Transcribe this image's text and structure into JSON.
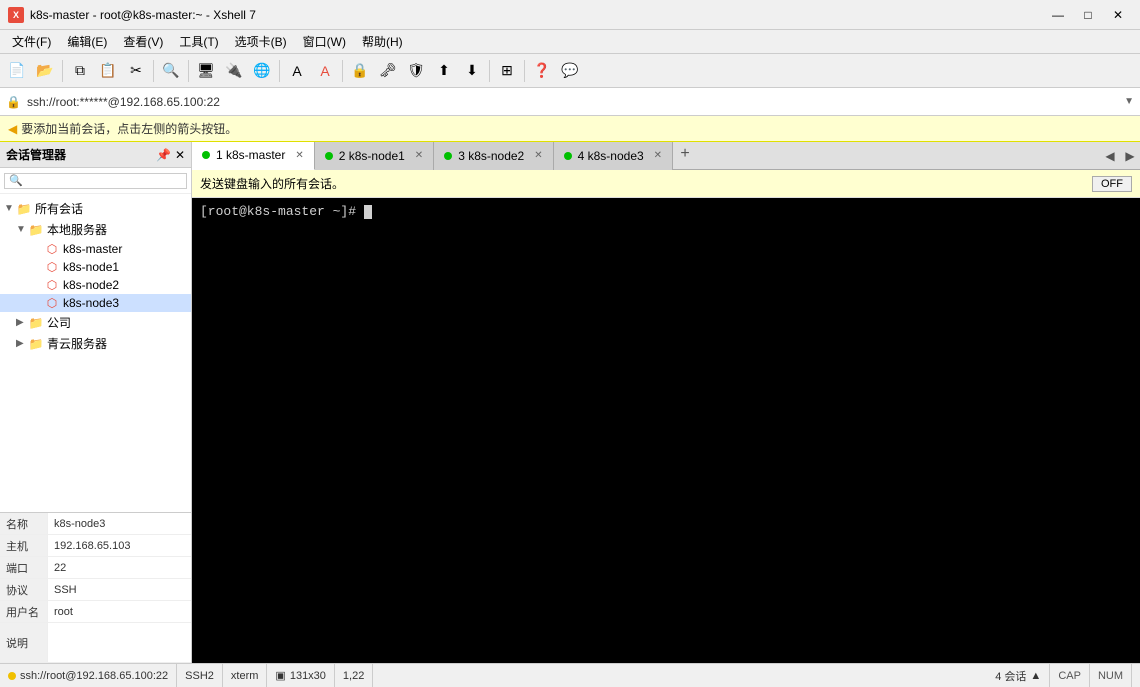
{
  "titlebar": {
    "icon_label": "X",
    "title": "k8s-master - root@k8s-master:~ - Xshell 7",
    "minimize": "—",
    "maximize": "□",
    "close": "✕"
  },
  "menu": {
    "items": [
      {
        "label": "文件(F)"
      },
      {
        "label": "编辑(E)"
      },
      {
        "label": "查看(V)"
      },
      {
        "label": "工具(T)"
      },
      {
        "label": "选项卡(B)"
      },
      {
        "label": "窗口(W)"
      },
      {
        "label": "帮助(H)"
      }
    ]
  },
  "address_bar": {
    "text": "ssh://root:******@192.168.65.100:22"
  },
  "hint_bar": {
    "text": "要添加当前会话，点击左侧的箭头按钮。"
  },
  "sidebar": {
    "title": "会话管理器",
    "tree": [
      {
        "id": "all",
        "label": "所有会话",
        "level": 0,
        "type": "folder",
        "expanded": true
      },
      {
        "id": "local",
        "label": "本地服务器",
        "level": 1,
        "type": "folder",
        "expanded": true
      },
      {
        "id": "master",
        "label": "k8s-master",
        "level": 2,
        "type": "server"
      },
      {
        "id": "node1",
        "label": "k8s-node1",
        "level": 2,
        "type": "server"
      },
      {
        "id": "node2",
        "label": "k8s-node2",
        "level": 2,
        "type": "server"
      },
      {
        "id": "node3",
        "label": "k8s-node3",
        "level": 2,
        "type": "server"
      },
      {
        "id": "company",
        "label": "公司",
        "level": 1,
        "type": "folder",
        "expanded": false
      },
      {
        "id": "cloud",
        "label": "青云服务器",
        "level": 1,
        "type": "folder",
        "expanded": false
      }
    ]
  },
  "session_info": {
    "fields": [
      {
        "label": "名称",
        "value": "k8s-node3"
      },
      {
        "label": "主机",
        "value": "192.168.65.103"
      },
      {
        "label": "端口",
        "value": "22"
      },
      {
        "label": "协议",
        "value": "SSH"
      },
      {
        "label": "用户名",
        "value": "root"
      },
      {
        "label": "说明",
        "value": ""
      }
    ]
  },
  "tabs": [
    {
      "id": 1,
      "label": "1 k8s-master",
      "active": true,
      "dot": "green"
    },
    {
      "id": 2,
      "label": "2 k8s-node1",
      "active": false,
      "dot": "green"
    },
    {
      "id": 3,
      "label": "3 k8s-node2",
      "active": false,
      "dot": "green"
    },
    {
      "id": 4,
      "label": "4 k8s-node3",
      "active": false,
      "dot": "green"
    }
  ],
  "broadcast": {
    "text": "发送键盘输入的所有会话。",
    "button_label": "OFF"
  },
  "terminal": {
    "prompt": "[root@k8s-master ~]# "
  },
  "statusbar": {
    "ssh_label": "SSH2",
    "xterm_label": "xterm",
    "dimensions": "131x30",
    "position": "1,22",
    "sessions": "4 会话",
    "sessions_icon": "▲",
    "cap_label": "CAP",
    "num_label": "NUM",
    "ssh_dot_color": "#f0c000",
    "address": "ssh://root@192.168.65.100:22"
  }
}
